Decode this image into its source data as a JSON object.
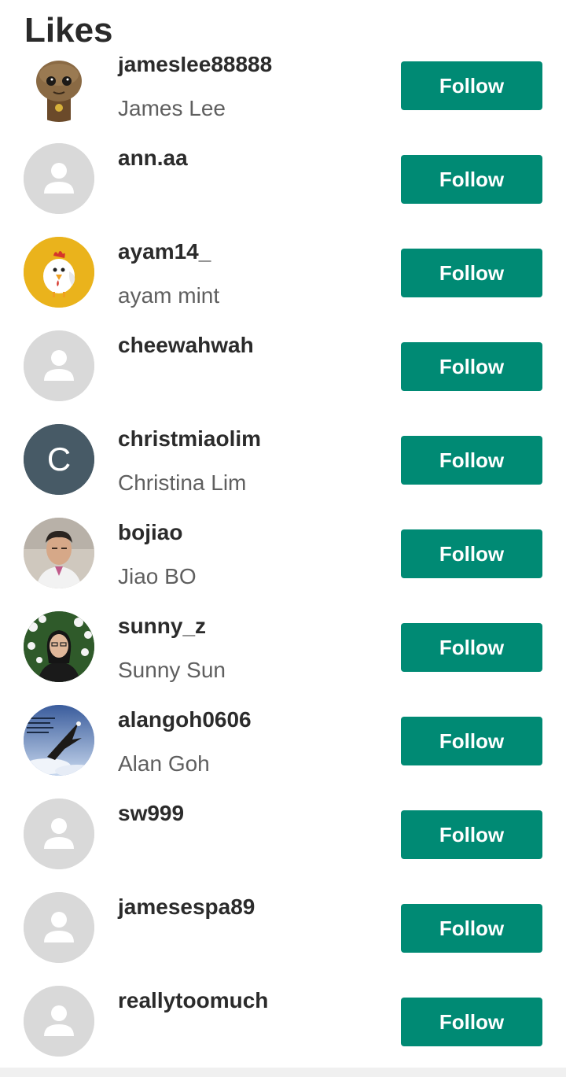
{
  "header": {
    "title": "Likes"
  },
  "colors": {
    "follow_button": "#008a74",
    "placeholder_avatar": "#d9d9d9",
    "letter_avatar": "#475a66"
  },
  "users": [
    {
      "username": "jameslee88888",
      "fullname": "James Lee",
      "avatar": "groot-figure-photo",
      "button": "Follow"
    },
    {
      "username": "ann.aa",
      "fullname": "",
      "avatar": "person-placeholder-icon",
      "button": "Follow"
    },
    {
      "username": "ayam14_",
      "fullname": "ayam mint",
      "avatar": "chicken-icon",
      "button": "Follow"
    },
    {
      "username": "cheewahwah",
      "fullname": "",
      "avatar": "person-placeholder-icon",
      "button": "Follow"
    },
    {
      "username": "christmiaolim",
      "fullname": "Christina Lim",
      "avatar": "letter-avatar",
      "avatar_letter": "C",
      "button": "Follow"
    },
    {
      "username": "bojiao",
      "fullname": "Jiao BO",
      "avatar": "man-portrait-photo",
      "button": "Follow"
    },
    {
      "username": "sunny_z",
      "fullname": "Sunny Sun",
      "avatar": "woman-portrait-photo",
      "button": "Follow"
    },
    {
      "username": "alangoh0606",
      "fullname": "Alan Goh",
      "avatar": "eagle-poster-photo",
      "button": "Follow"
    },
    {
      "username": "sw999",
      "fullname": "",
      "avatar": "person-placeholder-icon",
      "button": "Follow"
    },
    {
      "username": "jamesespa89",
      "fullname": "",
      "avatar": "person-placeholder-icon",
      "button": "Follow"
    },
    {
      "username": "reallytoomuch",
      "fullname": "",
      "avatar": "person-placeholder-icon",
      "button": "Follow"
    }
  ]
}
